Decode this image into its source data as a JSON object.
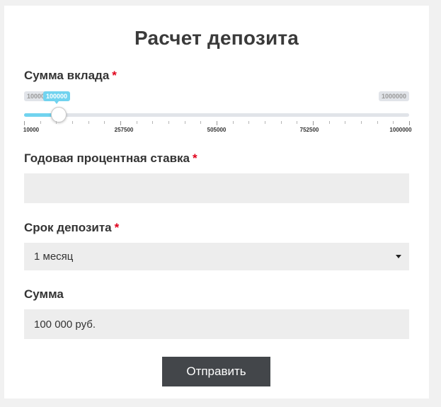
{
  "form": {
    "title": "Расчет депозита",
    "amount": {
      "label": "Сумма вклада",
      "required_mark": "*",
      "min_label": "10000",
      "max_label": "1000000",
      "current_label": "100000",
      "value_fraction": 0.0909,
      "ticks": [
        "10000",
        "257500",
        "505000",
        "752500",
        "1000000"
      ]
    },
    "rate": {
      "label": "Годовая процентная ставка",
      "required_mark": "*",
      "value": "",
      "placeholder": ""
    },
    "term": {
      "label": "Срок депозита",
      "required_mark": "*",
      "selected": "1 месяц"
    },
    "total": {
      "label": "Сумма",
      "value": "100 000 руб."
    },
    "submit_label": "Отправить"
  },
  "colors": {
    "accent": "#71d3ef",
    "required": "#e0001b",
    "button_bg": "#43464a",
    "input_bg": "#ededed"
  }
}
